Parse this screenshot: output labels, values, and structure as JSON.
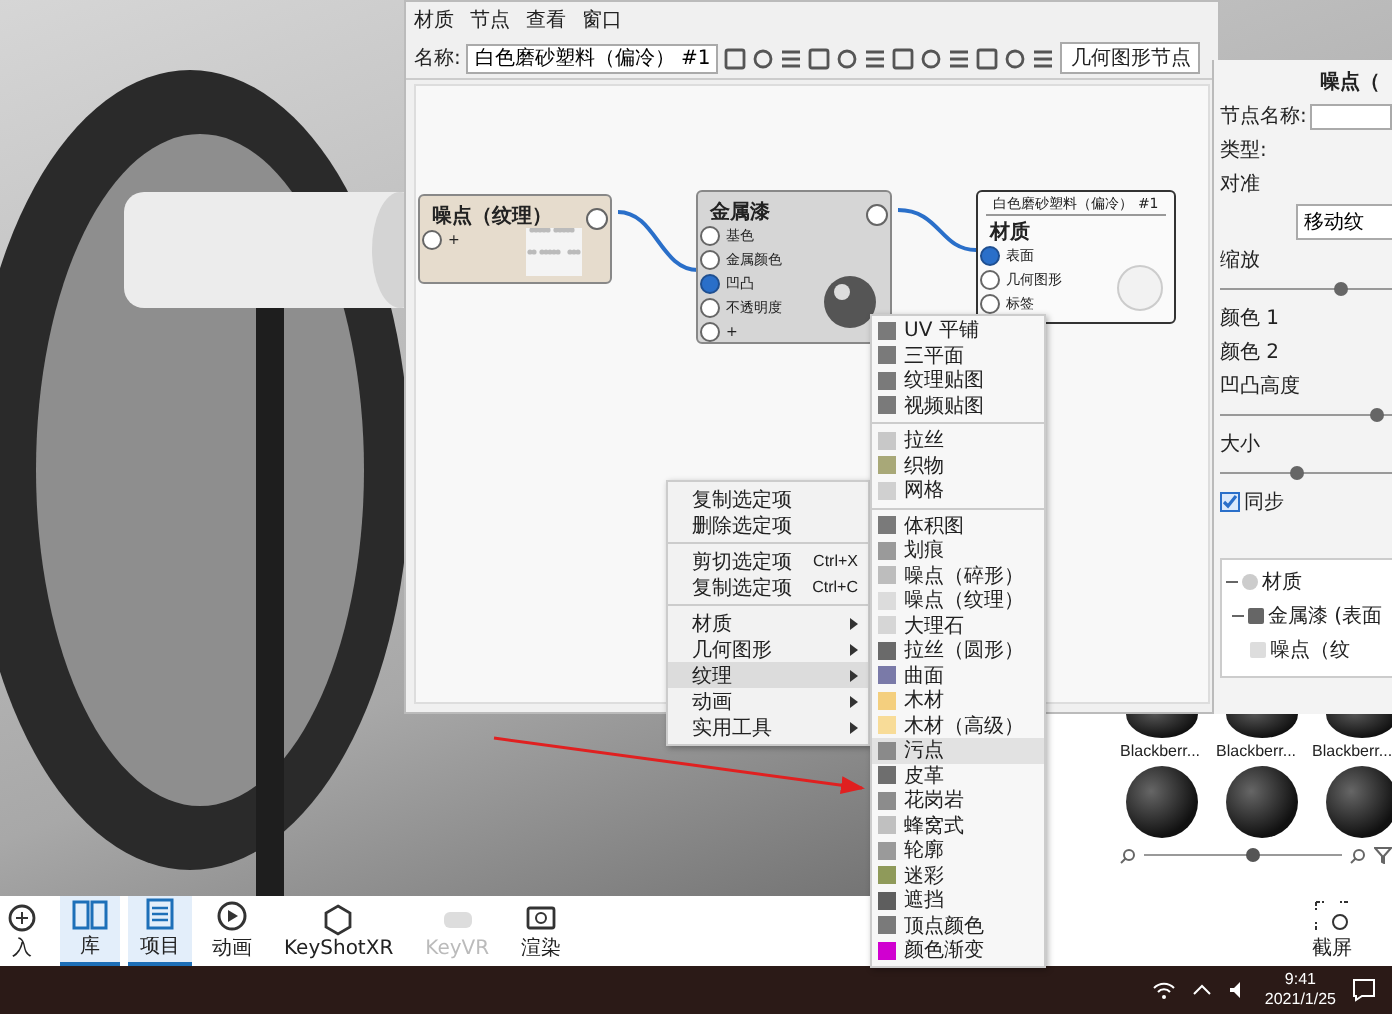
{
  "graph_window": {
    "menu": [
      "材质",
      "节点",
      "查看",
      "窗口"
    ],
    "name_label": "名称:",
    "name_value": "白色磨砂塑料（偏冷） #1",
    "node_type": "几何图形节点",
    "nodes": [
      {
        "kind": "texture",
        "title": "噪点（纹理）",
        "ports": [
          {
            "label": "+",
            "connected": false
          }
        ]
      },
      {
        "kind": "material",
        "title": "金属漆",
        "ports": [
          {
            "label": "基色",
            "connected": false
          },
          {
            "label": "金属颜色",
            "connected": false
          },
          {
            "label": "凹凸",
            "connected": true
          },
          {
            "label": "不透明度",
            "connected": false
          },
          {
            "label": "+",
            "connected": false
          }
        ]
      },
      {
        "kind": "output",
        "header": "白色磨砂塑料（偏冷） #1",
        "title": "材质",
        "ports": [
          {
            "label": "表面",
            "connected": true
          },
          {
            "label": "几何图形",
            "connected": false
          },
          {
            "label": "标签",
            "connected": false
          }
        ]
      }
    ]
  },
  "properties": {
    "title": "噪点（",
    "rows": [
      {
        "kind": "field",
        "label": "节点名称:"
      },
      {
        "kind": "label",
        "label": "类型:"
      },
      {
        "kind": "label",
        "label": "对准"
      },
      {
        "kind": "button",
        "label": "移动纹"
      },
      {
        "kind": "slider",
        "label": "缩放",
        "level": 0.5
      },
      {
        "kind": "label",
        "label": "颜色 1"
      },
      {
        "kind": "label",
        "label": "颜色 2"
      },
      {
        "kind": "slider",
        "label": "凹凸高度",
        "level": 0.65
      },
      {
        "kind": "slider",
        "label": "大小",
        "level": 0.32
      },
      {
        "kind": "checkbox",
        "label": "同步",
        "checked": true
      }
    ],
    "tree": [
      {
        "label": "材质",
        "expanded": true,
        "children": [
          {
            "label": "金属漆 (表面",
            "expanded": true,
            "children": [
              {
                "label": "噪点（纹"
              }
            ]
          }
        ]
      }
    ]
  },
  "context_menu": {
    "items": [
      {
        "kind": "action",
        "label": "复制选定项",
        "selected": false
      },
      {
        "kind": "action",
        "label": "删除选定项",
        "selected": false
      },
      {
        "kind": "separator"
      },
      {
        "kind": "action",
        "label": "剪切选定项",
        "shortcut": "Ctrl+X",
        "selected": false
      },
      {
        "kind": "action",
        "label": "复制选定项",
        "shortcut": "Ctrl+C",
        "selected": false
      },
      {
        "kind": "separator"
      },
      {
        "kind": "submenu",
        "label": "材质",
        "selected": false
      },
      {
        "kind": "submenu",
        "label": "几何图形",
        "selected": false
      },
      {
        "kind": "submenu",
        "label": "纹理",
        "selected": true
      },
      {
        "kind": "submenu",
        "label": "动画",
        "selected": false
      },
      {
        "kind": "submenu",
        "label": "实用工具",
        "selected": false
      }
    ]
  },
  "submenu": {
    "items": [
      {
        "kind": "item",
        "label": "UV 平铺",
        "color": "#7a7a7a",
        "selected": false
      },
      {
        "kind": "item",
        "label": "三平面",
        "color": "#7a7a7a",
        "selected": false
      },
      {
        "kind": "item",
        "label": "纹理贴图",
        "color": "#7a7a7a",
        "selected": false
      },
      {
        "kind": "item",
        "label": "视频贴图",
        "color": "#7a7a7a",
        "selected": false
      },
      {
        "kind": "separator"
      },
      {
        "kind": "item",
        "label": "拉丝",
        "color": "#c8c8c8",
        "selected": false
      },
      {
        "kind": "item",
        "label": "织物",
        "color": "#a8a878",
        "selected": false
      },
      {
        "kind": "item",
        "label": "网格",
        "color": "#d0d0d0",
        "selected": false
      },
      {
        "kind": "separator"
      },
      {
        "kind": "item",
        "label": "体积图",
        "color": "#7a7a7a",
        "selected": false
      },
      {
        "kind": "item",
        "label": "划痕",
        "color": "#9a9a9a",
        "selected": false
      },
      {
        "kind": "item",
        "label": "噪点（碎形）",
        "color": "#bdbdbd",
        "selected": false
      },
      {
        "kind": "item",
        "label": "噪点（纹理）",
        "color": "#dcdcdc",
        "selected": false
      },
      {
        "kind": "item",
        "label": "大理石",
        "color": "#d6d6d6",
        "selected": false
      },
      {
        "kind": "item",
        "label": "拉丝（圆形）",
        "color": "#6a6a6a",
        "selected": false
      },
      {
        "kind": "item",
        "label": "曲面",
        "color": "#7a7aa8",
        "selected": false
      },
      {
        "kind": "item",
        "label": "木材",
        "color": "#f4cf7e",
        "selected": false
      },
      {
        "kind": "item",
        "label": "木材（高级）",
        "color": "#f8dc98",
        "selected": false
      },
      {
        "kind": "item",
        "label": "污点",
        "color": "#8a8a8a",
        "selected": true
      },
      {
        "kind": "item",
        "label": "皮革",
        "color": "#6e6e6e",
        "selected": false
      },
      {
        "kind": "item",
        "label": "花岗岩",
        "color": "#8c8c8c",
        "selected": false
      },
      {
        "kind": "item",
        "label": "蜂窝式",
        "color": "#c0c0c0",
        "selected": false
      },
      {
        "kind": "item",
        "label": "轮廓",
        "color": "#9a9a9a",
        "selected": false
      },
      {
        "kind": "item",
        "label": "迷彩",
        "color": "#8f9a5a",
        "selected": false
      },
      {
        "kind": "item",
        "label": "遮挡",
        "color": "#5e5e5e",
        "selected": false
      },
      {
        "kind": "item",
        "label": "顶点颜色",
        "color": "#7a7a7a",
        "selected": false
      },
      {
        "kind": "item",
        "label": "颜色渐变",
        "color": "#d000d0",
        "selected": false
      }
    ]
  },
  "library": {
    "labels": [
      "Blackberr...",
      "Blackberr...",
      "Blackberr..."
    ],
    "zoom": {
      "level": 0.55
    }
  },
  "toolbar": {
    "items": [
      {
        "kind": "import",
        "label": "入",
        "selected": false,
        "disabled": false
      },
      {
        "kind": "library",
        "label": "库",
        "selected": true,
        "disabled": false
      },
      {
        "kind": "project",
        "label": "项目",
        "selected": true,
        "disabled": false
      },
      {
        "kind": "animation",
        "label": "动画",
        "selected": false,
        "disabled": false
      },
      {
        "kind": "xr",
        "label": "KeyShotXR",
        "selected": false,
        "disabled": false
      },
      {
        "kind": "vr",
        "label": "KeyVR",
        "selected": false,
        "disabled": true
      },
      {
        "kind": "render",
        "label": "渲染",
        "selected": false,
        "disabled": false
      }
    ],
    "screenshot": "截屏"
  },
  "taskbar": {
    "time": "9:41",
    "date": "2021/1/25"
  }
}
